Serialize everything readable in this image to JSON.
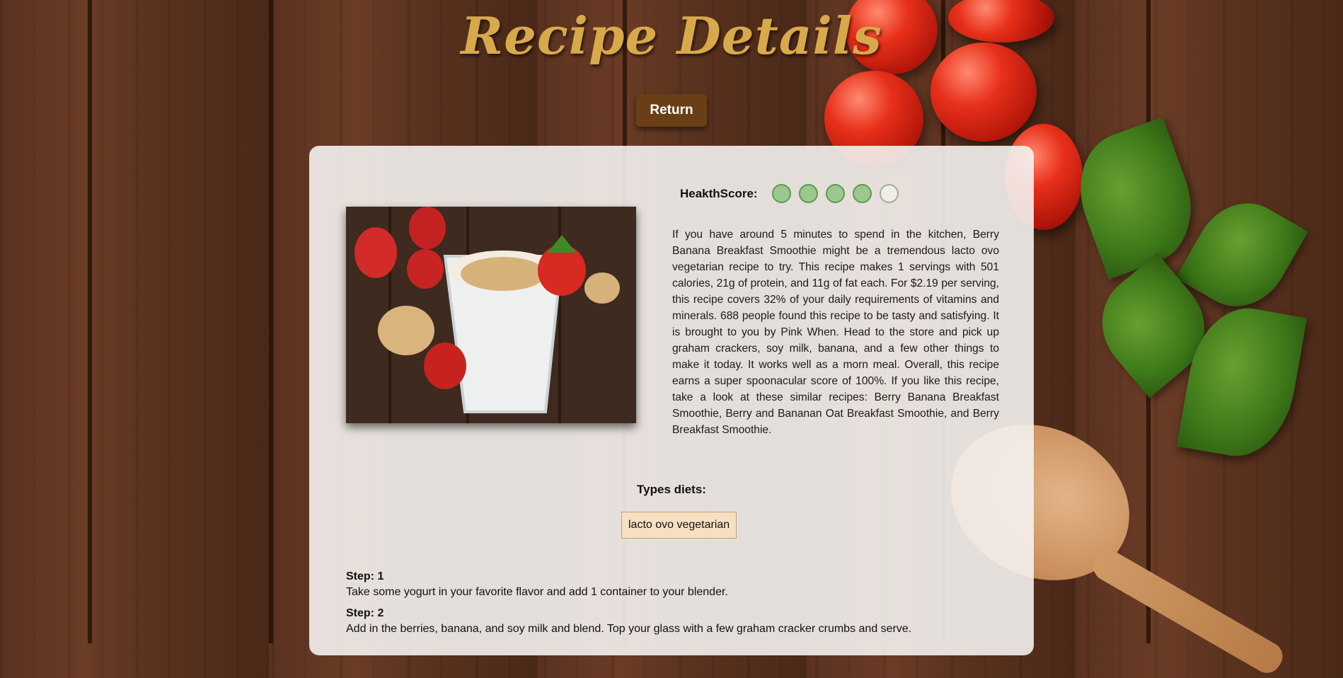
{
  "header": {
    "title": "Recipe Details",
    "return_label": "Return"
  },
  "health": {
    "label": "HeakthScore:",
    "filled": 4,
    "total": 5
  },
  "recipe": {
    "summary": "If you have around 5 minutes to spend in the kitchen, Berry Banana Breakfast Smoothie might be a tremendous lacto ovo vegetarian recipe to try. This recipe makes 1 servings with 501 calories, 21g of protein, and 11g of fat each. For $2.19 per serving, this recipe covers 32% of your daily requirements of vitamins and minerals. 688 people found this recipe to be tasty and satisfying. It is brought to you by Pink When. Head to the store and pick up graham crackers, soy milk, banana, and a few other things to make it today. It works well as a morn meal. Overall, this recipe earns a super spoonacular score of 100%. If you like this recipe, take a look at these similar recipes: Berry Banana Breakfast Smoothie, Berry and Bananan Oat Breakfast Smoothie, and Berry Breakfast Smoothie."
  },
  "diets": {
    "title": "Types diets:",
    "items": [
      "lacto ovo vegetarian"
    ]
  },
  "steps": [
    {
      "title": "Step: 1",
      "text": "Take some yogurt in your favorite flavor and add 1 container to your blender."
    },
    {
      "title": "Step: 2",
      "text": "Add in the berries, banana, and soy milk and blend. Top your glass with a few graham cracker crumbs and serve."
    }
  ],
  "colors": {
    "title": "#d8a94a",
    "button": "#6b3f16",
    "health_fill": "#9cc88f",
    "chip_bg": "#f7e0c2"
  }
}
